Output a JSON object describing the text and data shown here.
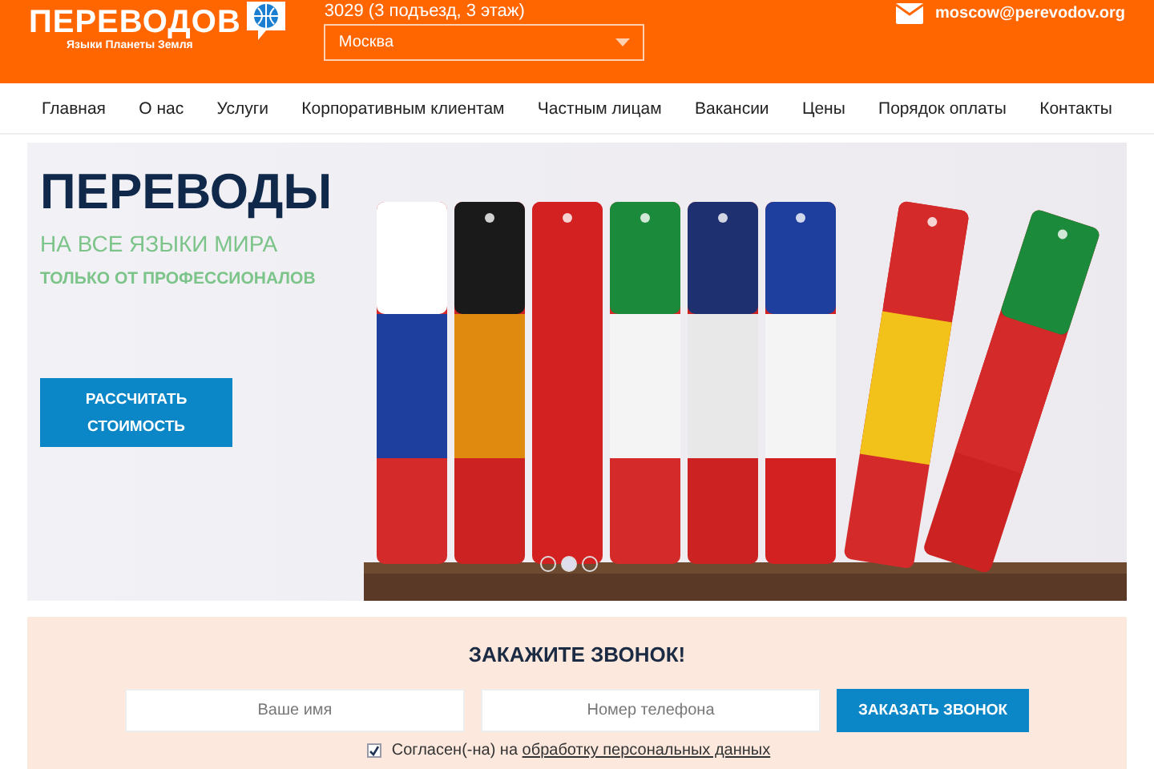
{
  "header": {
    "logo": {
      "title": "ПЕРЕВОДОВ",
      "tagline": "Языки Планеты Земля"
    },
    "address": "3029 (3 подъезд, 3 этаж)",
    "city_select": {
      "value": "Москва"
    },
    "email": "moscow@perevodov.org"
  },
  "nav": [
    "Главная",
    "О нас",
    "Услуги",
    "Корпоративным клиентам",
    "Частным лицам",
    "Вакансии",
    "Цены",
    "Порядок оплаты",
    "Контакты"
  ],
  "banner": {
    "title": "ПЕРЕВОДЫ",
    "subtitle": "НА ВСЕ ЯЗЫКИ МИРА",
    "tagline": "ТОЛЬКО ОТ ПРОФЕССИОНАЛОВ",
    "button": "РАССЧИТАТЬ СТОИМОСТЬ",
    "slides": [
      {
        "selected": false
      },
      {
        "selected": true
      },
      {
        "selected": false
      }
    ]
  },
  "callback": {
    "title": "ЗАКАЖИТЕ ЗВОНОК!",
    "name_field": {
      "placeholder": "Ваше имя"
    },
    "phone_field": {
      "placeholder": "Номер телефона"
    },
    "button": "ЗАКАЗАТЬ ЗВОНОК",
    "consent": {
      "checked": true,
      "text": "Согласен(-на) на ",
      "link": "обработку персональных данных"
    }
  }
}
